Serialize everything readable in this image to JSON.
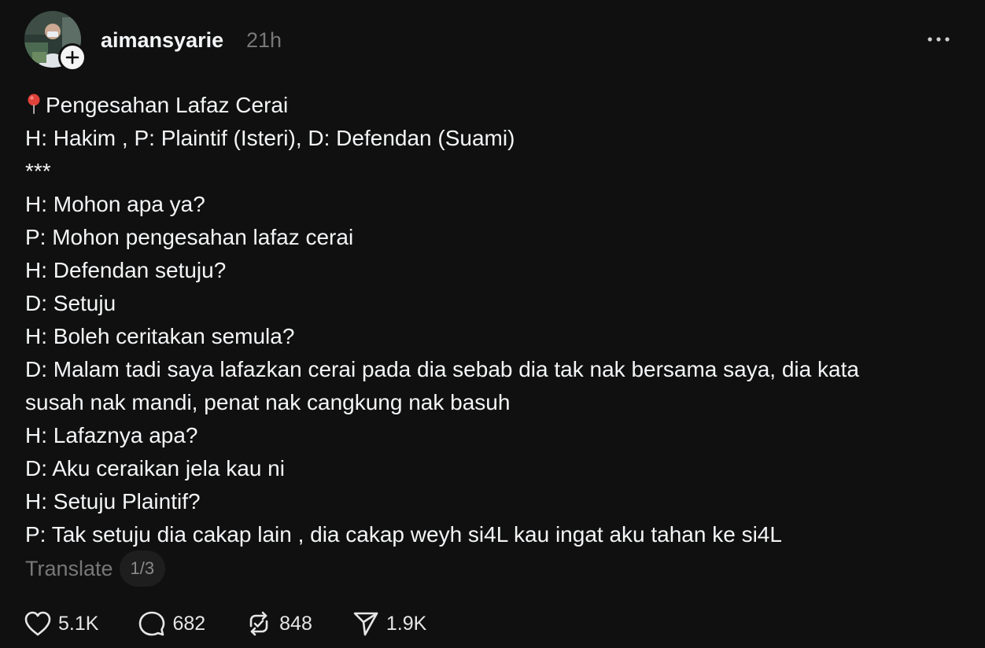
{
  "post": {
    "author": "aimansyarie",
    "time": "21h",
    "lines": [
      "Pengesahan Lafaz Cerai",
      "H: Hakim , P: Plaintif (Isteri), D: Defendan (Suami)",
      "***",
      "H: Mohon apa ya?",
      "P: Mohon pengesahan lafaz cerai",
      "H: Defendan setuju?",
      "D: Setuju",
      "H: Boleh ceritakan semula?",
      "D: Malam tadi saya lafazkan cerai pada dia sebab dia tak nak bersama saya, dia kata",
      "susah nak mandi, penat nak cangkung nak basuh",
      "H: Lafaznya apa?",
      "D: Aku ceraikan jela kau ni",
      "H: Setuju Plaintif?",
      "P: Tak setuju dia cakap lain , dia cakap weyh si4L kau ingat aku tahan ke si4L"
    ],
    "translate_label": "Translate",
    "page_indicator": "1/3"
  },
  "actions": {
    "likes": "5.1K",
    "replies": "682",
    "reposts": "848",
    "shares": "1.9K"
  },
  "icons": {
    "title_prefix": "pin-icon",
    "follow": "plus-icon",
    "more": "more-icon",
    "like": "heart-icon",
    "reply": "comment-icon",
    "repost": "repost-icon",
    "share": "send-icon"
  },
  "colors": {
    "background": "#101010",
    "text": "#f3f5f7",
    "muted": "#777777",
    "pin": "#e0423a"
  }
}
